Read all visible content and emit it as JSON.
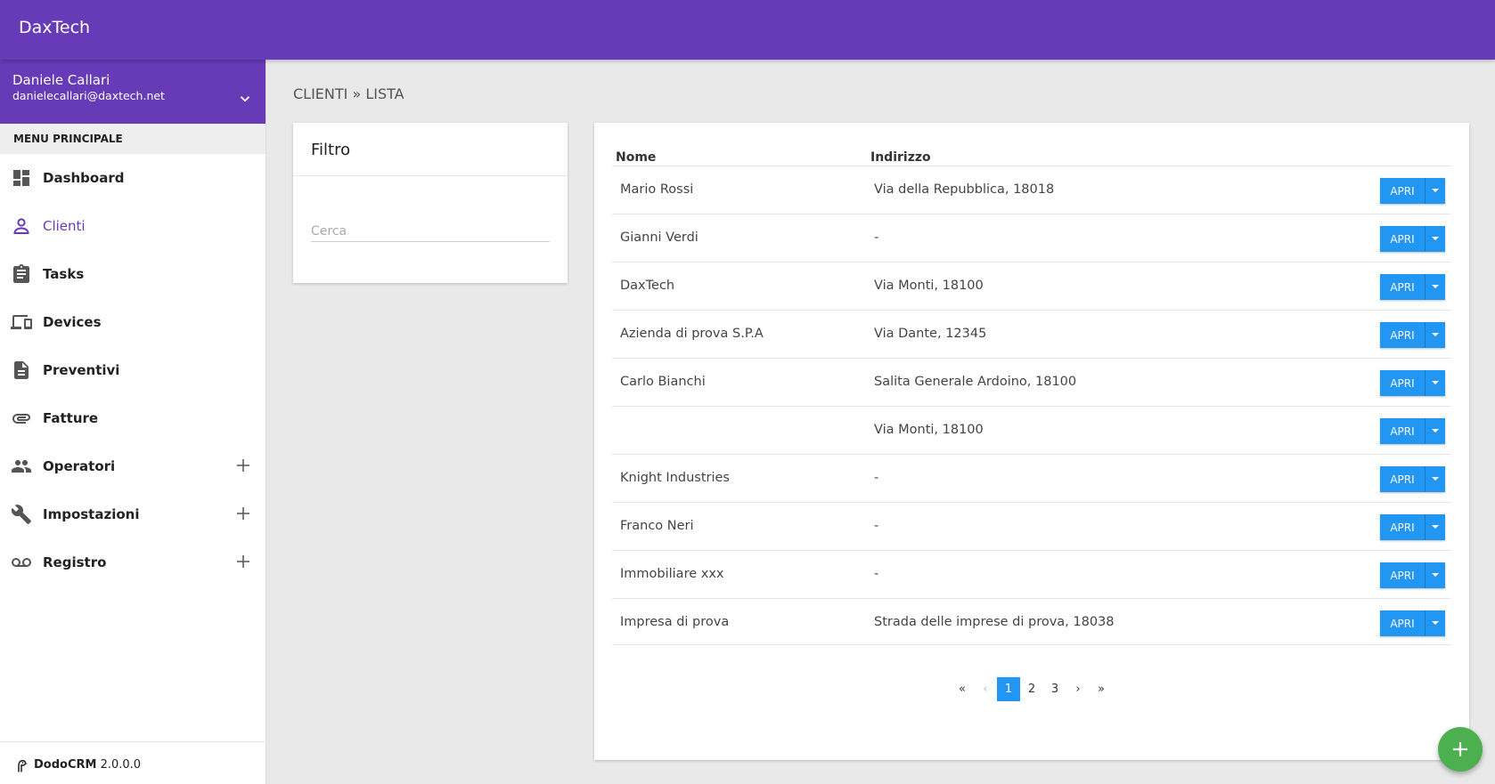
{
  "app": {
    "title": "DaxTech"
  },
  "user": {
    "name": "Daniele Callari",
    "email": "danielecallari@daxtech.net"
  },
  "menu": {
    "header": "MENU PRINCIPALE",
    "items": [
      {
        "label": "Dashboard",
        "icon": "dashboard-icon"
      },
      {
        "label": "Clienti",
        "icon": "person-icon",
        "active": true
      },
      {
        "label": "Tasks",
        "icon": "clipboard-icon"
      },
      {
        "label": "Devices",
        "icon": "devices-icon"
      },
      {
        "label": "Preventivi",
        "icon": "document-icon"
      },
      {
        "label": "Fatture",
        "icon": "attachment-icon"
      },
      {
        "label": "Operatori",
        "icon": "people-icon",
        "expandable": true
      },
      {
        "label": "Impostazioni",
        "icon": "wrench-icon",
        "expandable": true
      },
      {
        "label": "Registro",
        "icon": "voicemail-icon",
        "expandable": true
      }
    ]
  },
  "footer": {
    "app_name": "DodoCRM",
    "version": "2.0.0.0"
  },
  "breadcrumb": {
    "section": "CLIENTI",
    "separator": "»",
    "page": "LISTA"
  },
  "filter": {
    "title": "Filtro",
    "search_placeholder": "Cerca",
    "search_value": ""
  },
  "table": {
    "columns": {
      "name": "Nome",
      "address": "Indirizzo"
    },
    "rows": [
      {
        "name": "Mario Rossi",
        "address": "Via della Repubblica, 18018"
      },
      {
        "name": "Gianni Verdi",
        "address": "-"
      },
      {
        "name": "DaxTech",
        "address": "Via Monti, 18100"
      },
      {
        "name": "Azienda di prova S.P.A",
        "address": "Via Dante, 12345"
      },
      {
        "name": "Carlo Bianchi",
        "address": "Salita Generale Ardoino, 18100"
      },
      {
        "name": "",
        "address": "Via Monti, 18100"
      },
      {
        "name": "Knight Industries",
        "address": "-"
      },
      {
        "name": "Franco Neri",
        "address": "-"
      },
      {
        "name": "Immobiliare xxx",
        "address": "-"
      },
      {
        "name": "Impresa di prova",
        "address": "Strada delle imprese di prova, 18038"
      }
    ],
    "open_label": "APRI"
  },
  "pagination": {
    "first": "«",
    "prev": "‹",
    "pages": [
      "1",
      "2",
      "3"
    ],
    "current": "1",
    "next": "›",
    "last": "»"
  },
  "colors": {
    "primary": "#673ab7",
    "accent": "#2196f3",
    "fab": "#4caf50"
  }
}
